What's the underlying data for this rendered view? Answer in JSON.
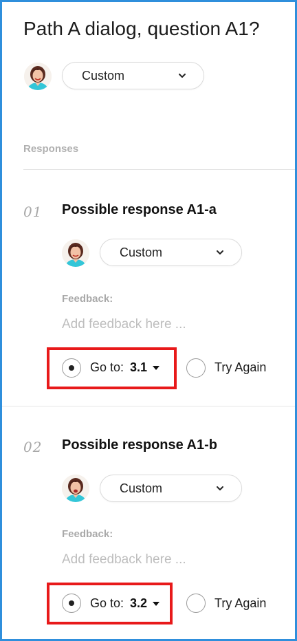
{
  "dialog": {
    "title": "Path A dialog, question A1?",
    "speaker": {
      "avatar_icon": "presenter-avatar-icon",
      "selected": "Custom"
    }
  },
  "responses_section": {
    "label": "Responses",
    "items": [
      {
        "number": "01",
        "title": "Possible response A1-a",
        "speaker_selected": "Custom",
        "feedback_label": "Feedback:",
        "feedback_placeholder": "Add feedback here ...",
        "feedback_value": "",
        "goto_label": "Go to:",
        "goto_value": "3.1",
        "goto_selected": true,
        "try_again_label": "Try Again",
        "try_again_selected": false
      },
      {
        "number": "02",
        "title": "Possible response A1-b",
        "speaker_selected": "Custom",
        "feedback_label": "Feedback:",
        "feedback_placeholder": "Add feedback here ...",
        "feedback_value": "",
        "goto_label": "Go to:",
        "goto_value": "3.2",
        "goto_selected": true,
        "try_again_label": "Try Again",
        "try_again_selected": false
      }
    ]
  },
  "colors": {
    "frame_border": "#2f8fdc",
    "highlight": "#e8191a",
    "muted_label": "#b0b0b0",
    "placeholder": "#bdbdbd"
  }
}
